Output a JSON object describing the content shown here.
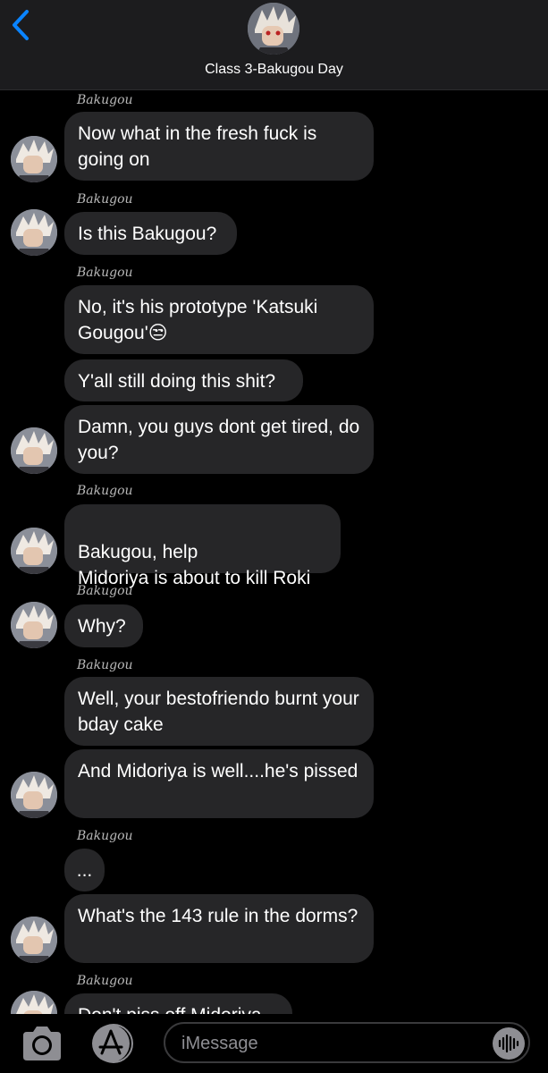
{
  "header": {
    "title": "Class 3-Bakugou Day"
  },
  "messages": [
    {
      "sender": "Bakugou",
      "text": "Now what in the fresh fuck is going on"
    },
    {
      "sender": "Bakugou",
      "text": "Is this Bakugou?"
    },
    {
      "sender": "Bakugou",
      "text": "No, it's his prototype 'Katsuki Gougou'",
      "emoji": "😒"
    },
    {
      "text": "Y'all still doing this shit?"
    },
    {
      "text": "Damn, you guys dont get tired, do you?"
    },
    {
      "sender": "Bakugou",
      "text": "Bakugou, help\nMidoriya is about to kill Roki"
    },
    {
      "sender": "Bakugou",
      "text": "Why?"
    },
    {
      "sender": "Bakugou",
      "text": "Well, your bestofriendo burnt your bday cake"
    },
    {
      "text": "And Midoriya is well....he's pissed"
    },
    {
      "sender": "Bakugou",
      "text": "..."
    },
    {
      "text": "What's the 143 rule in the dorms?"
    },
    {
      "sender": "Bakugou",
      "text": "Don't piss off Midoriya"
    }
  ],
  "composer": {
    "placeholder": "iMessage"
  },
  "colors": {
    "accent": "#0a84ff",
    "bubble": "#262628",
    "header": "#1c1c1e"
  },
  "icons": [
    "back-chevron-icon",
    "camera-icon",
    "app-store-icon",
    "audio-waveform-icon"
  ]
}
